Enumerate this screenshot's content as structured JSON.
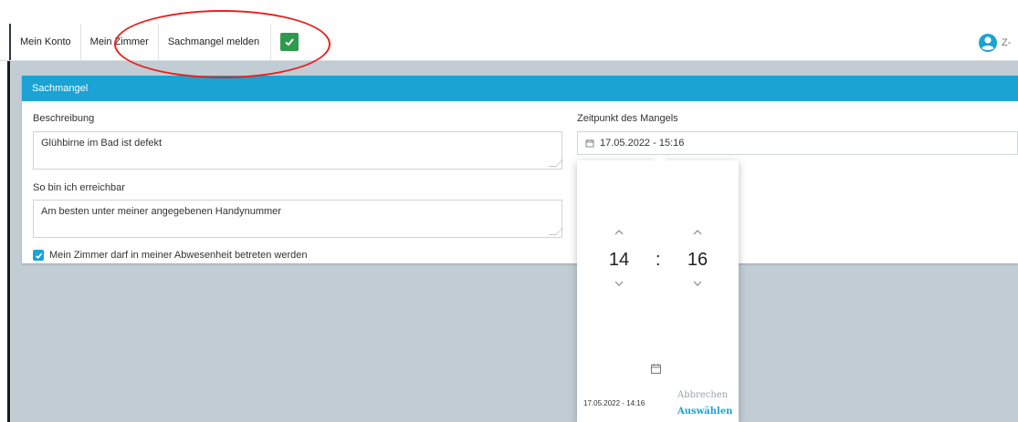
{
  "breadcrumb": {
    "items": [
      "Mein Konto",
      "Mein Zimmer",
      "Sachmangel melden"
    ]
  },
  "header": {
    "user_label": "Z-"
  },
  "panel": {
    "title": "Sachmangel",
    "beschreibung": {
      "label": "Beschreibung",
      "value": "Glühbirne im Bad ist defekt"
    },
    "erreichbar": {
      "label": "So bin ich erreichbar",
      "value": "Am besten unter meiner angegebenen Handynummer"
    },
    "checkbox": {
      "label": "Mein Zimmer darf in meiner Abwesenheit betreten werden",
      "checked": true
    },
    "zeitpunkt": {
      "label": "Zeitpunkt des Mangels",
      "value": "17.05.2022 - 15:16"
    }
  },
  "picker": {
    "hour": "14",
    "minute": "16",
    "separator": ":",
    "footer_value": "17.05.2022 - 14:16",
    "cancel_label": "Abbrechen",
    "select_label": "Auswählen"
  },
  "colors": {
    "accent": "#1aa3d3",
    "success": "#2e9a4b",
    "annotation": "#e8211f"
  }
}
